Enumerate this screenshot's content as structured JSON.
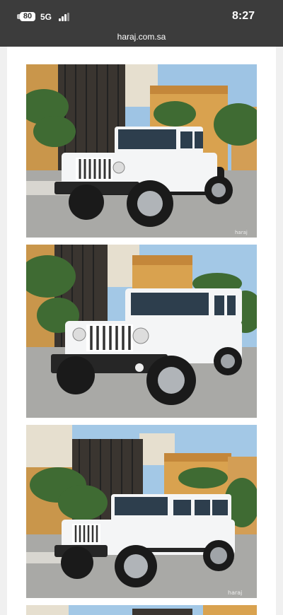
{
  "status_bar": {
    "battery": "80",
    "network": "5G",
    "time": "8:27"
  },
  "browser": {
    "url": "haraj.com.sa"
  },
  "listing": {
    "photos": [
      {
        "subject": "white-jeep-wrangler-front-left"
      },
      {
        "subject": "white-jeep-wrangler-front-left-close"
      },
      {
        "subject": "white-jeep-wrangler-side-left"
      }
    ]
  },
  "colors": {
    "status_bar_bg": "#3c3c3c",
    "page_bg": "#ffffff",
    "vehicle": "#f4f5f6"
  }
}
